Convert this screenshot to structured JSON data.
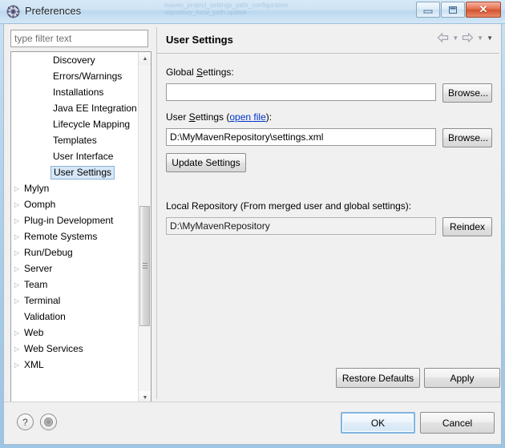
{
  "window": {
    "title": "Preferences",
    "icon": "preferences-gear-icon",
    "controls": {
      "minimize": "minimize-button",
      "maximize": "maximize-button",
      "close": "close-button",
      "close_glyph": "✕",
      "maximize_glyph": "❐"
    },
    "background_ghost_lines": [
      "maven_project_settings_path_configuration",
      "repository_local_path   update"
    ]
  },
  "filter": {
    "placeholder": "type filter text",
    "value": ""
  },
  "tree": {
    "items": [
      {
        "label": "Discovery",
        "level": "child",
        "expandable": false,
        "selected": false
      },
      {
        "label": "Errors/Warnings",
        "level": "child",
        "expandable": false,
        "selected": false
      },
      {
        "label": "Installations",
        "level": "child",
        "expandable": false,
        "selected": false
      },
      {
        "label": "Java EE Integration",
        "level": "child",
        "expandable": false,
        "selected": false
      },
      {
        "label": "Lifecycle Mapping",
        "level": "child",
        "expandable": false,
        "selected": false
      },
      {
        "label": "Templates",
        "level": "child",
        "expandable": false,
        "selected": false
      },
      {
        "label": "User Interface",
        "level": "child",
        "expandable": false,
        "selected": false
      },
      {
        "label": "User Settings",
        "level": "child",
        "expandable": false,
        "selected": true
      },
      {
        "label": "Mylyn",
        "level": "root",
        "expandable": true,
        "selected": false
      },
      {
        "label": "Oomph",
        "level": "root",
        "expandable": true,
        "selected": false
      },
      {
        "label": "Plug-in Development",
        "level": "root",
        "expandable": true,
        "selected": false
      },
      {
        "label": "Remote Systems",
        "level": "root",
        "expandable": true,
        "selected": false
      },
      {
        "label": "Run/Debug",
        "level": "root",
        "expandable": true,
        "selected": false
      },
      {
        "label": "Server",
        "level": "root",
        "expandable": true,
        "selected": false
      },
      {
        "label": "Team",
        "level": "root",
        "expandable": true,
        "selected": false
      },
      {
        "label": "Terminal",
        "level": "root",
        "expandable": true,
        "selected": false
      },
      {
        "label": "Validation",
        "level": "nochild",
        "expandable": false,
        "selected": false
      },
      {
        "label": "Web",
        "level": "root",
        "expandable": true,
        "selected": false
      },
      {
        "label": "Web Services",
        "level": "root",
        "expandable": true,
        "selected": false
      },
      {
        "label": "XML",
        "level": "root",
        "expandable": true,
        "selected": false
      }
    ],
    "expand_glyph": "▷",
    "scroll_up_glyph": "▲",
    "scroll_down_glyph": "▼",
    "scroll_left_glyph": "◀",
    "scroll_right_glyph": "▶"
  },
  "page": {
    "title": "User Settings",
    "nav": {
      "back": "back-arrow-icon",
      "forward": "forward-arrow-icon",
      "chevron": "▼"
    },
    "global_settings": {
      "label_pre": "Global ",
      "label_mnemonic": "S",
      "label_post": "ettings:",
      "value": "",
      "browse_label": "Browse..."
    },
    "user_settings": {
      "label_pre": "User ",
      "label_mnemonic": "S",
      "label_mid": "ettings (",
      "link": "open file",
      "label_post": "):",
      "value": "D:\\MyMavenRepository\\settings.xml",
      "browse_label": "Browse...",
      "update_label": "Update Settings"
    },
    "local_repository": {
      "label": "Local Repository (From merged user and global settings):",
      "value": "D:\\MyMavenRepository",
      "reindex_label": "Reindex"
    },
    "restore_defaults_label": "Restore Defaults",
    "apply_label": "Apply"
  },
  "footer": {
    "help_glyph": "?",
    "help_name": "help-icon",
    "second_icon_name": "cheat-sheet-icon",
    "ok_label": "OK",
    "cancel_label": "Cancel"
  }
}
